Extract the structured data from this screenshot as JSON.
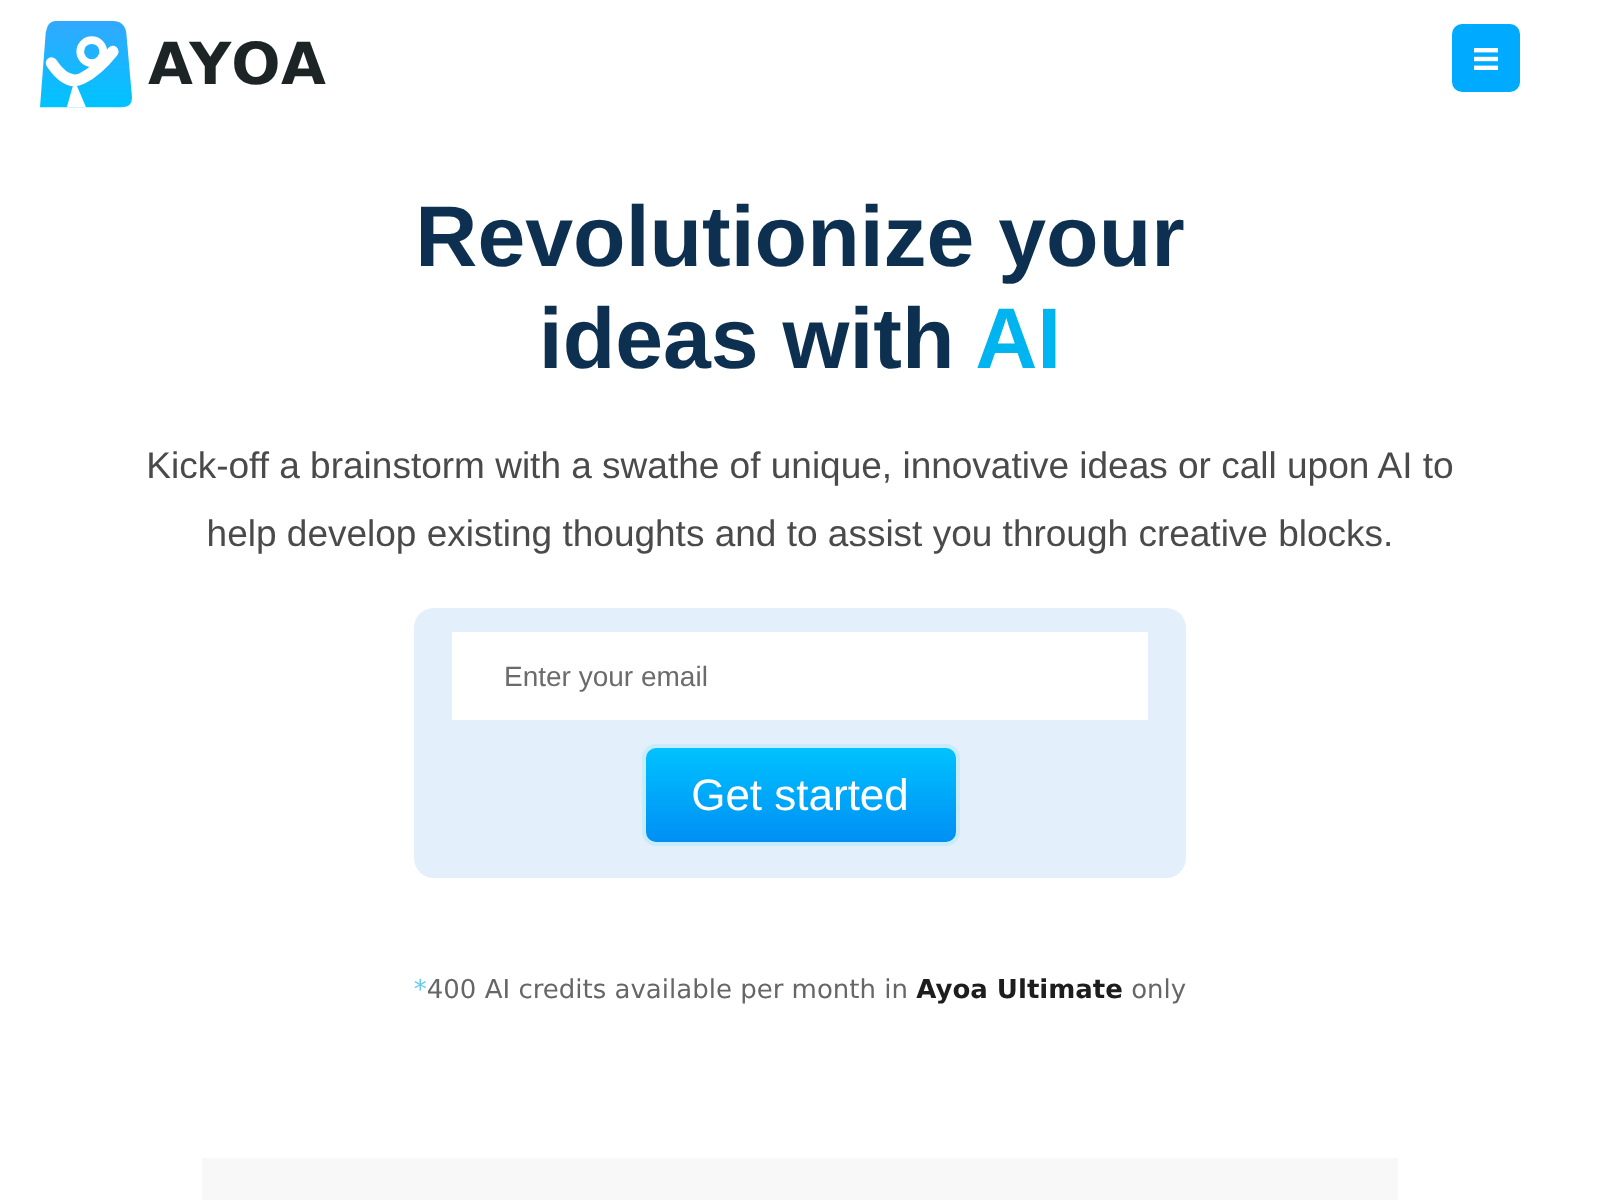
{
  "header": {
    "logo": {
      "text": "AYOA"
    }
  },
  "hero": {
    "headline": {
      "text": "Revolutionize your ideas with",
      "highlight": "AI"
    },
    "subtitle": "Kick-off a brainstorm with a swathe of unique, innovative ideas or call upon AI to help develop existing thoughts and to assist you through creative blocks.",
    "signup": {
      "email": {
        "placeholder": "Enter your email"
      },
      "button": "Get started"
    },
    "footnote": {
      "marker": "*",
      "text": "400 AI credits available per month in **Ayoa Ultimate** only"
    }
  }
}
